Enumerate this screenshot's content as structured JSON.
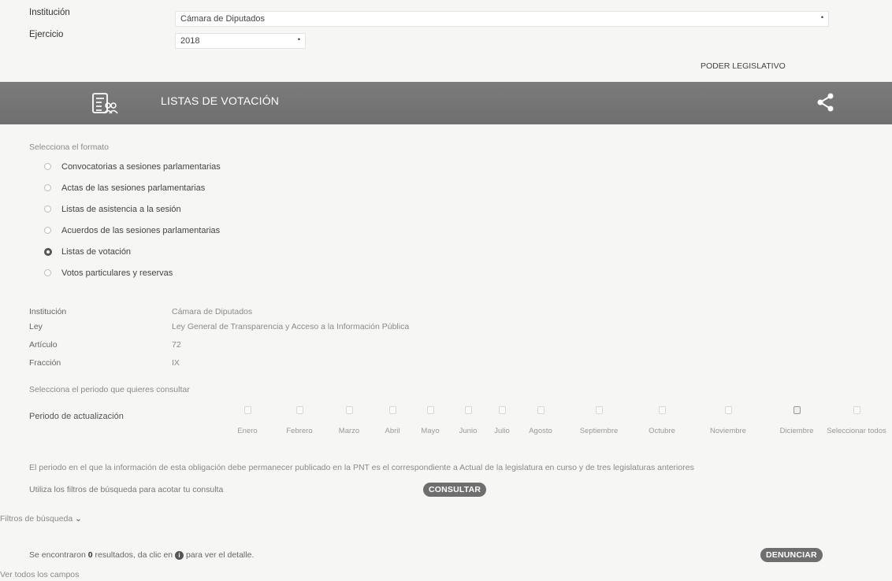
{
  "top": {
    "institucion_label": "Institución",
    "institucion_value": "Cámara de Diputados",
    "ejercicio_label": "Ejercicio",
    "ejercicio_value": "2018",
    "poder": "PODER LEGISLATIVO"
  },
  "band": {
    "title": "LISTAS DE VOTACIÓN"
  },
  "formato": {
    "prompt": "Selecciona el formato",
    "options": [
      {
        "label": "Convocatorias a sesiones parlamentarias",
        "checked": false
      },
      {
        "label": "Actas de las sesiones parlamentarias",
        "checked": false
      },
      {
        "label": "Listas de asistencia a la sesión",
        "checked": false
      },
      {
        "label": "Acuerdos de las sesiones parlamentarias",
        "checked": false
      },
      {
        "label": "Listas de votación",
        "checked": true
      },
      {
        "label": "Votos particulares y reservas",
        "checked": false
      }
    ]
  },
  "info": {
    "rows": [
      {
        "label": "Institución",
        "value": "Cámara de Diputados"
      },
      {
        "label": "Ley",
        "value": "Ley General de Transparencia y Acceso a la Información Pública"
      },
      {
        "label": "Artículo",
        "value": "72"
      },
      {
        "label": "Fracción",
        "value": "IX"
      }
    ]
  },
  "periodo": {
    "prompt": "Selecciona el periodo que quieres consultar",
    "label": "Periodo de actualización",
    "months": [
      "Enero",
      "Febrero",
      "Marzo",
      "Abril",
      "Mayo",
      "Junio",
      "Julio",
      "Agosto",
      "Septiembre",
      "Octubre",
      "Noviembre",
      "Diciembre",
      "Seleccionar todos"
    ],
    "checked_index": 11
  },
  "notes": {
    "publicacion": "El periodo en el que la información de esta obligación debe permanecer publicado en la PNT es el correspondiente a Actual de la legislatura en curso y de tres legislaturas anteriores",
    "filtros_hint": "Utiliza los filtros de búsqueda para acotar tu consulta",
    "consultar": "CONSULTAR",
    "filtros": "Filtros de búsqueda",
    "resultados_pre": "Se encontraron ",
    "resultados_count": "0",
    "resultados_post": " resultados, da clic en ",
    "resultados_end": " para ver el detalle.",
    "denunciar": "DENUNCIAR",
    "ver_todos": "Ver todos los campos"
  }
}
